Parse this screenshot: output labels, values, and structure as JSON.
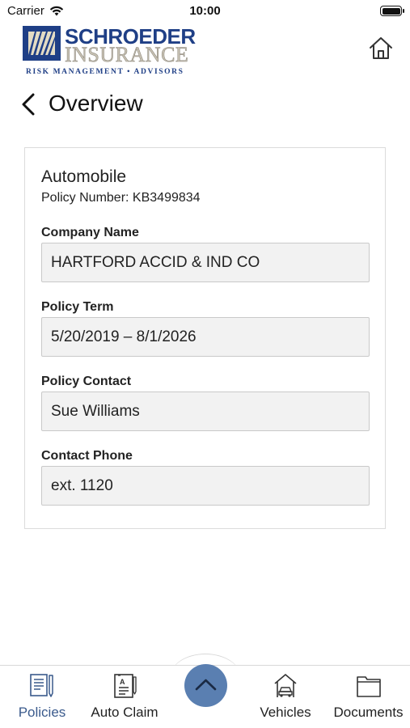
{
  "status_bar": {
    "carrier": "Carrier",
    "time": "10:00"
  },
  "brand": {
    "name_line1": "SCHROEDER",
    "name_line2": "INSURANCE",
    "tagline": "RISK MANAGEMENT • ADVISORS",
    "primary_color": "#1f3f86"
  },
  "header": {
    "home_icon": "home-icon"
  },
  "nav": {
    "title": "Overview",
    "back_icon": "chevron-left-icon"
  },
  "policy": {
    "type": "Automobile",
    "number_label": "Policy Number: KB3499834",
    "fields": [
      {
        "label": "Company Name",
        "value": "HARTFORD ACCID & IND CO"
      },
      {
        "label": "Policy Term",
        "value": "5/20/2019 – 8/1/2026"
      },
      {
        "label": "Policy Contact",
        "value": "Sue Williams"
      },
      {
        "label": "Contact Phone",
        "value": "ext. 1120"
      }
    ]
  },
  "tabbar": {
    "tabs": [
      {
        "label": "Policies",
        "icon": "policies-icon",
        "active": true
      },
      {
        "label": "Auto Claim",
        "icon": "auto-claim-icon",
        "active": false
      },
      {
        "label": "Vehicles",
        "icon": "vehicles-icon",
        "active": false
      },
      {
        "label": "Documents",
        "icon": "documents-icon",
        "active": false
      }
    ],
    "center_icon": "chevron-up-icon",
    "active_color": "#3a5a8c",
    "center_color": "#5a7fb1"
  }
}
